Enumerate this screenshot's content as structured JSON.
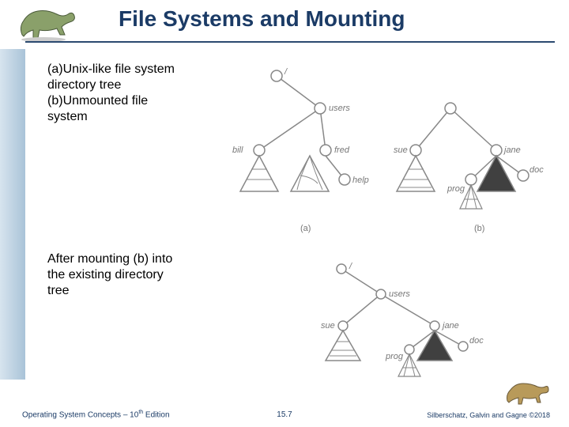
{
  "title": "File Systems and Mounting",
  "para": {
    "a_label": "(a)",
    "a_text": "Unix-like file system directory tree",
    "b_label": "(b)",
    "b_text": "Unmounted file system"
  },
  "para2": "After mounting (b) into the existing directory tree",
  "fig1": {
    "root": "/",
    "users": "users",
    "bill": "bill",
    "fred": "fred",
    "help": "help",
    "sue": "sue",
    "jane": "jane",
    "prog": "prog",
    "doc": "doc",
    "cap_a": "(a)",
    "cap_b": "(b)"
  },
  "fig2": {
    "root": "/",
    "users": "users",
    "sue": "sue",
    "jane": "jane",
    "prog": "prog",
    "doc": "doc"
  },
  "footer": {
    "left_pre": "Operating System Concepts – 10",
    "left_sup": "th",
    "left_post": " Edition",
    "center": "15.7",
    "right": "Silberschatz, Galvin and Gagne ©2018"
  }
}
